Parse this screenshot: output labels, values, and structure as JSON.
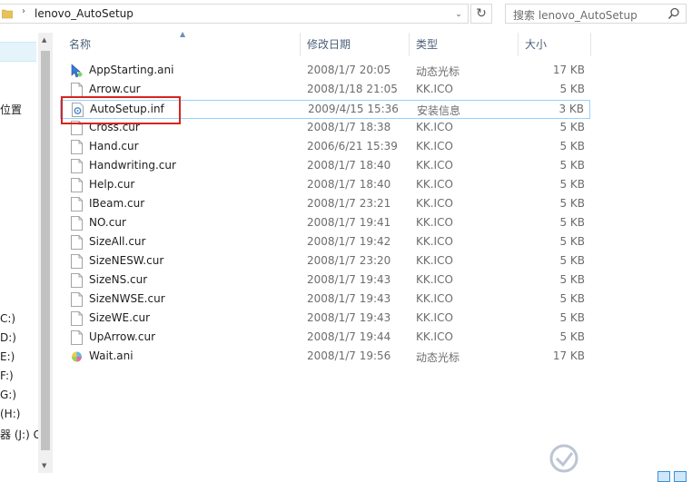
{
  "address": {
    "separator": "›",
    "path": "lenovo_AutoSetup",
    "dropdown": "⌄",
    "refresh": "↻"
  },
  "search": {
    "placeholder": "搜索 lenovo_AutoSetup"
  },
  "nav": {
    "items": [
      "位置",
      "C:)",
      "D:)",
      "E:)",
      "F:)",
      "G:)",
      "(H:)",
      "器 (J:) G"
    ]
  },
  "columns": {
    "name": "名称",
    "date": "修改日期",
    "type": "类型",
    "size": "大小"
  },
  "files": [
    {
      "name": "AppStarting.ani",
      "date": "2008/1/7 20:05",
      "type": "动态光标",
      "size": "17 KB",
      "icon": "animated-cursor-icon"
    },
    {
      "name": "Arrow.cur",
      "date": "2008/1/18 21:05",
      "type": "KK.ICO",
      "size": "5 KB",
      "icon": "file-icon"
    },
    {
      "name": "AutoSetup.inf",
      "date": "2009/4/15 15:36",
      "type": "安装信息",
      "size": "3 KB",
      "icon": "setup-info-icon",
      "selected": true
    },
    {
      "name": "Cross.cur",
      "date": "2008/1/7 18:38",
      "type": "KK.ICO",
      "size": "5 KB",
      "icon": "file-icon"
    },
    {
      "name": "Hand.cur",
      "date": "2006/6/21 15:39",
      "type": "KK.ICO",
      "size": "5 KB",
      "icon": "file-icon"
    },
    {
      "name": "Handwriting.cur",
      "date": "2008/1/7 18:40",
      "type": "KK.ICO",
      "size": "5 KB",
      "icon": "file-icon"
    },
    {
      "name": "Help.cur",
      "date": "2008/1/7 18:40",
      "type": "KK.ICO",
      "size": "5 KB",
      "icon": "file-icon"
    },
    {
      "name": "IBeam.cur",
      "date": "2008/1/7 23:21",
      "type": "KK.ICO",
      "size": "5 KB",
      "icon": "file-icon"
    },
    {
      "name": "NO.cur",
      "date": "2008/1/7 19:41",
      "type": "KK.ICO",
      "size": "5 KB",
      "icon": "file-icon"
    },
    {
      "name": "SizeAll.cur",
      "date": "2008/1/7 19:42",
      "type": "KK.ICO",
      "size": "5 KB",
      "icon": "file-icon"
    },
    {
      "name": "SizeNESW.cur",
      "date": "2008/1/7 23:20",
      "type": "KK.ICO",
      "size": "5 KB",
      "icon": "file-icon"
    },
    {
      "name": "SizeNS.cur",
      "date": "2008/1/7 19:43",
      "type": "KK.ICO",
      "size": "5 KB",
      "icon": "file-icon"
    },
    {
      "name": "SizeNWSE.cur",
      "date": "2008/1/7 19:43",
      "type": "KK.ICO",
      "size": "5 KB",
      "icon": "file-icon"
    },
    {
      "name": "SizeWE.cur",
      "date": "2008/1/7 19:43",
      "type": "KK.ICO",
      "size": "5 KB",
      "icon": "file-icon"
    },
    {
      "name": "UpArrow.cur",
      "date": "2008/1/7 19:44",
      "type": "KK.ICO",
      "size": "5 KB",
      "icon": "file-icon"
    },
    {
      "name": "Wait.ani",
      "date": "2008/1/7 19:56",
      "type": "动态光标",
      "size": "17 KB",
      "icon": "animated-cursor-icon"
    }
  ],
  "colors": {
    "selection_border": "#99d1ff",
    "highlight_box": "#d9231f",
    "header_text": "#4c607a"
  }
}
